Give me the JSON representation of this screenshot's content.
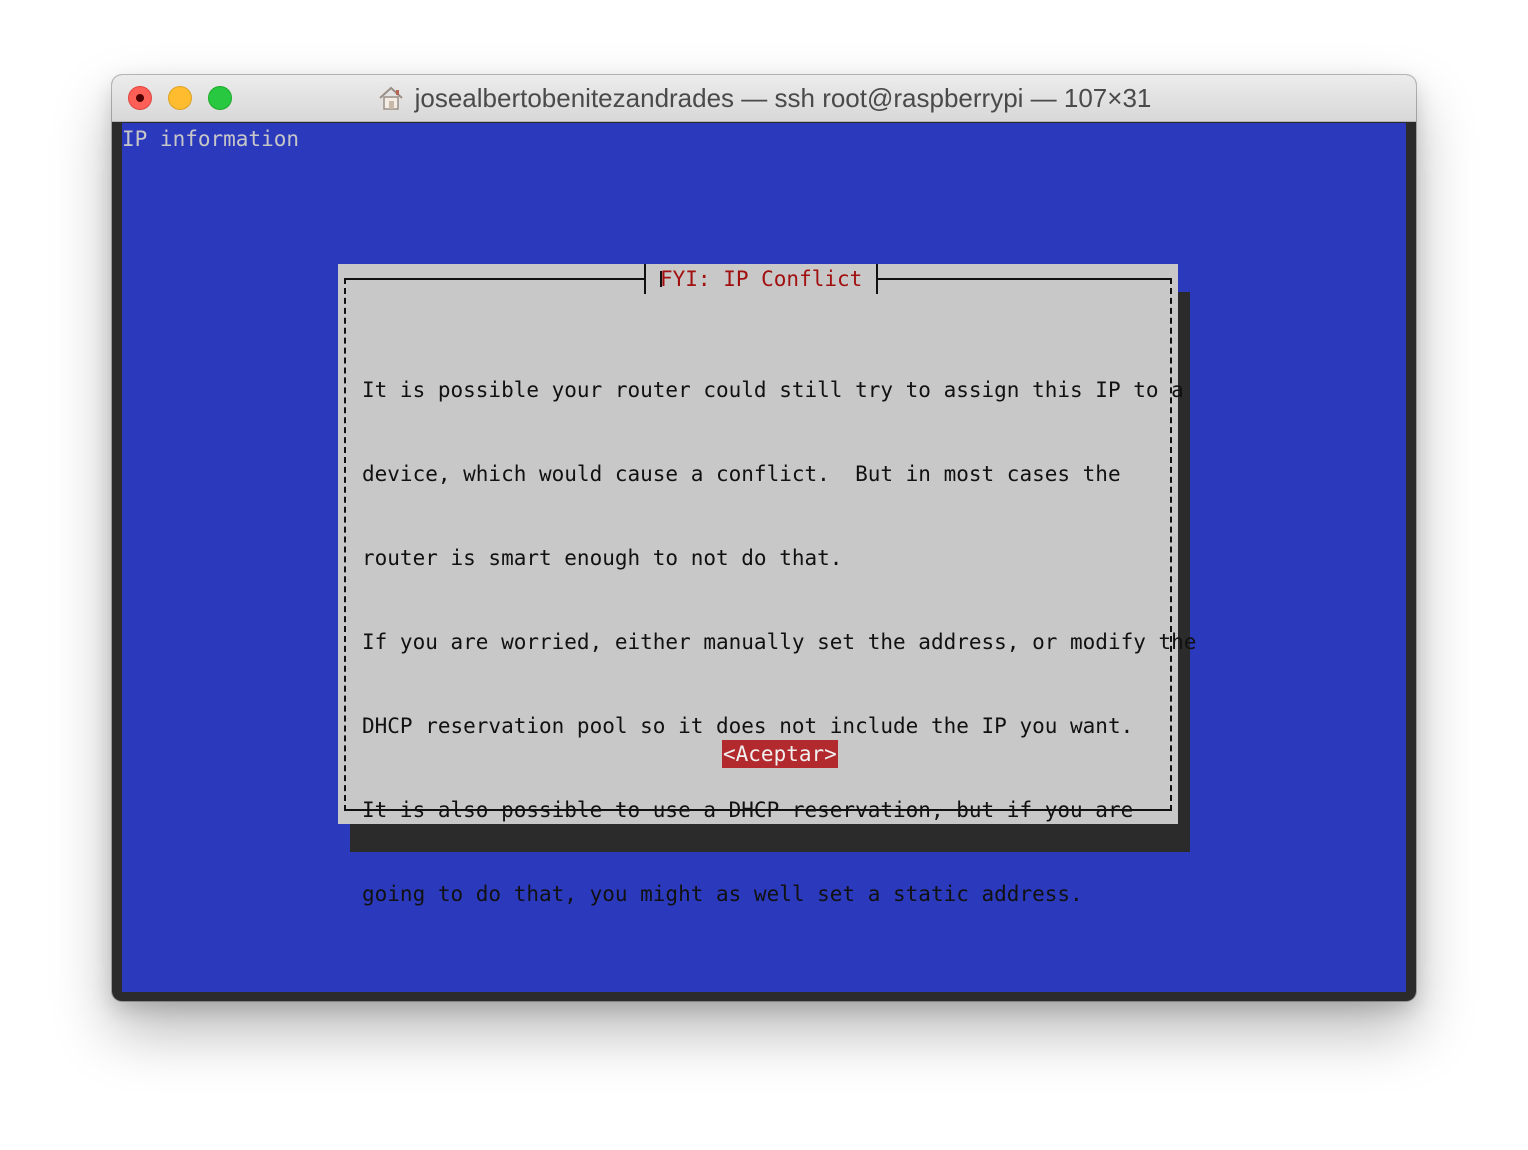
{
  "window": {
    "title": "josealbertobenitezandrades — ssh root@raspberrypi — 107×31"
  },
  "terminal": {
    "backtitle": "IP information",
    "dialog": {
      "title": "FYI: IP Conflict",
      "lines": [
        "It is possible your router could still try to assign this IP to a",
        "device, which would cause a conflict.  But in most cases the",
        "router is smart enough to not do that.",
        "If you are worried, either manually set the address, or modify the",
        "DHCP reservation pool so it does not include the IP you want.",
        "It is also possible to use a DHCP reservation, but if you are",
        "going to do that, you might as well set a static address."
      ],
      "ok_label": "<Aceptar>"
    }
  },
  "colors": {
    "terminal_bg": "#2b3abd",
    "dialog_bg": "#c8c8c8",
    "dialog_title": "#a10f0f",
    "button_bg": "#b32a2e"
  }
}
